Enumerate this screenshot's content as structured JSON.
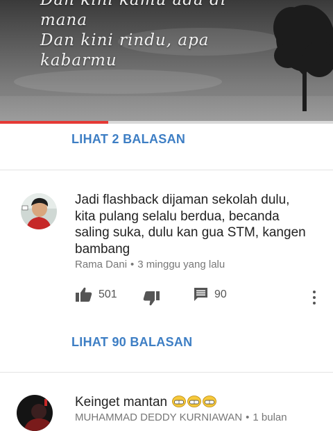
{
  "video": {
    "lyrics": [
      "Dan kini kamu ada di",
      "mana",
      "Dan kini rindu, apa",
      "kabarmu"
    ],
    "progress": 0.325,
    "progress_color": "#e53935"
  },
  "thread1": {
    "view_replies_label": "LIHAT 2 BALASAN"
  },
  "comment1": {
    "text_lines": [
      "Jadi flashback dijaman sekolah dulu,",
      "kita pulang selalu berdua, becanda",
      "saling suka, dulu kan gua STM, kangen",
      "bambang"
    ],
    "author": "Rama Dani",
    "separator": "•",
    "time": "3 minggu yang lalu",
    "likes": "501",
    "replies_count": "90",
    "view_replies_label": "LIHAT 90 BALASAN"
  },
  "comment2": {
    "text": "Keinget mantan",
    "emoji_icons": [
      "grinning-face-icon",
      "grinning-face-icon",
      "grinning-face-icon"
    ],
    "author": "MUHAMMAD DEDDY KURNIAWAN",
    "separator": "•",
    "time": "1 bulan"
  },
  "colors": {
    "link": "#3d7ec4",
    "text": "#222222",
    "meta": "#777777"
  }
}
